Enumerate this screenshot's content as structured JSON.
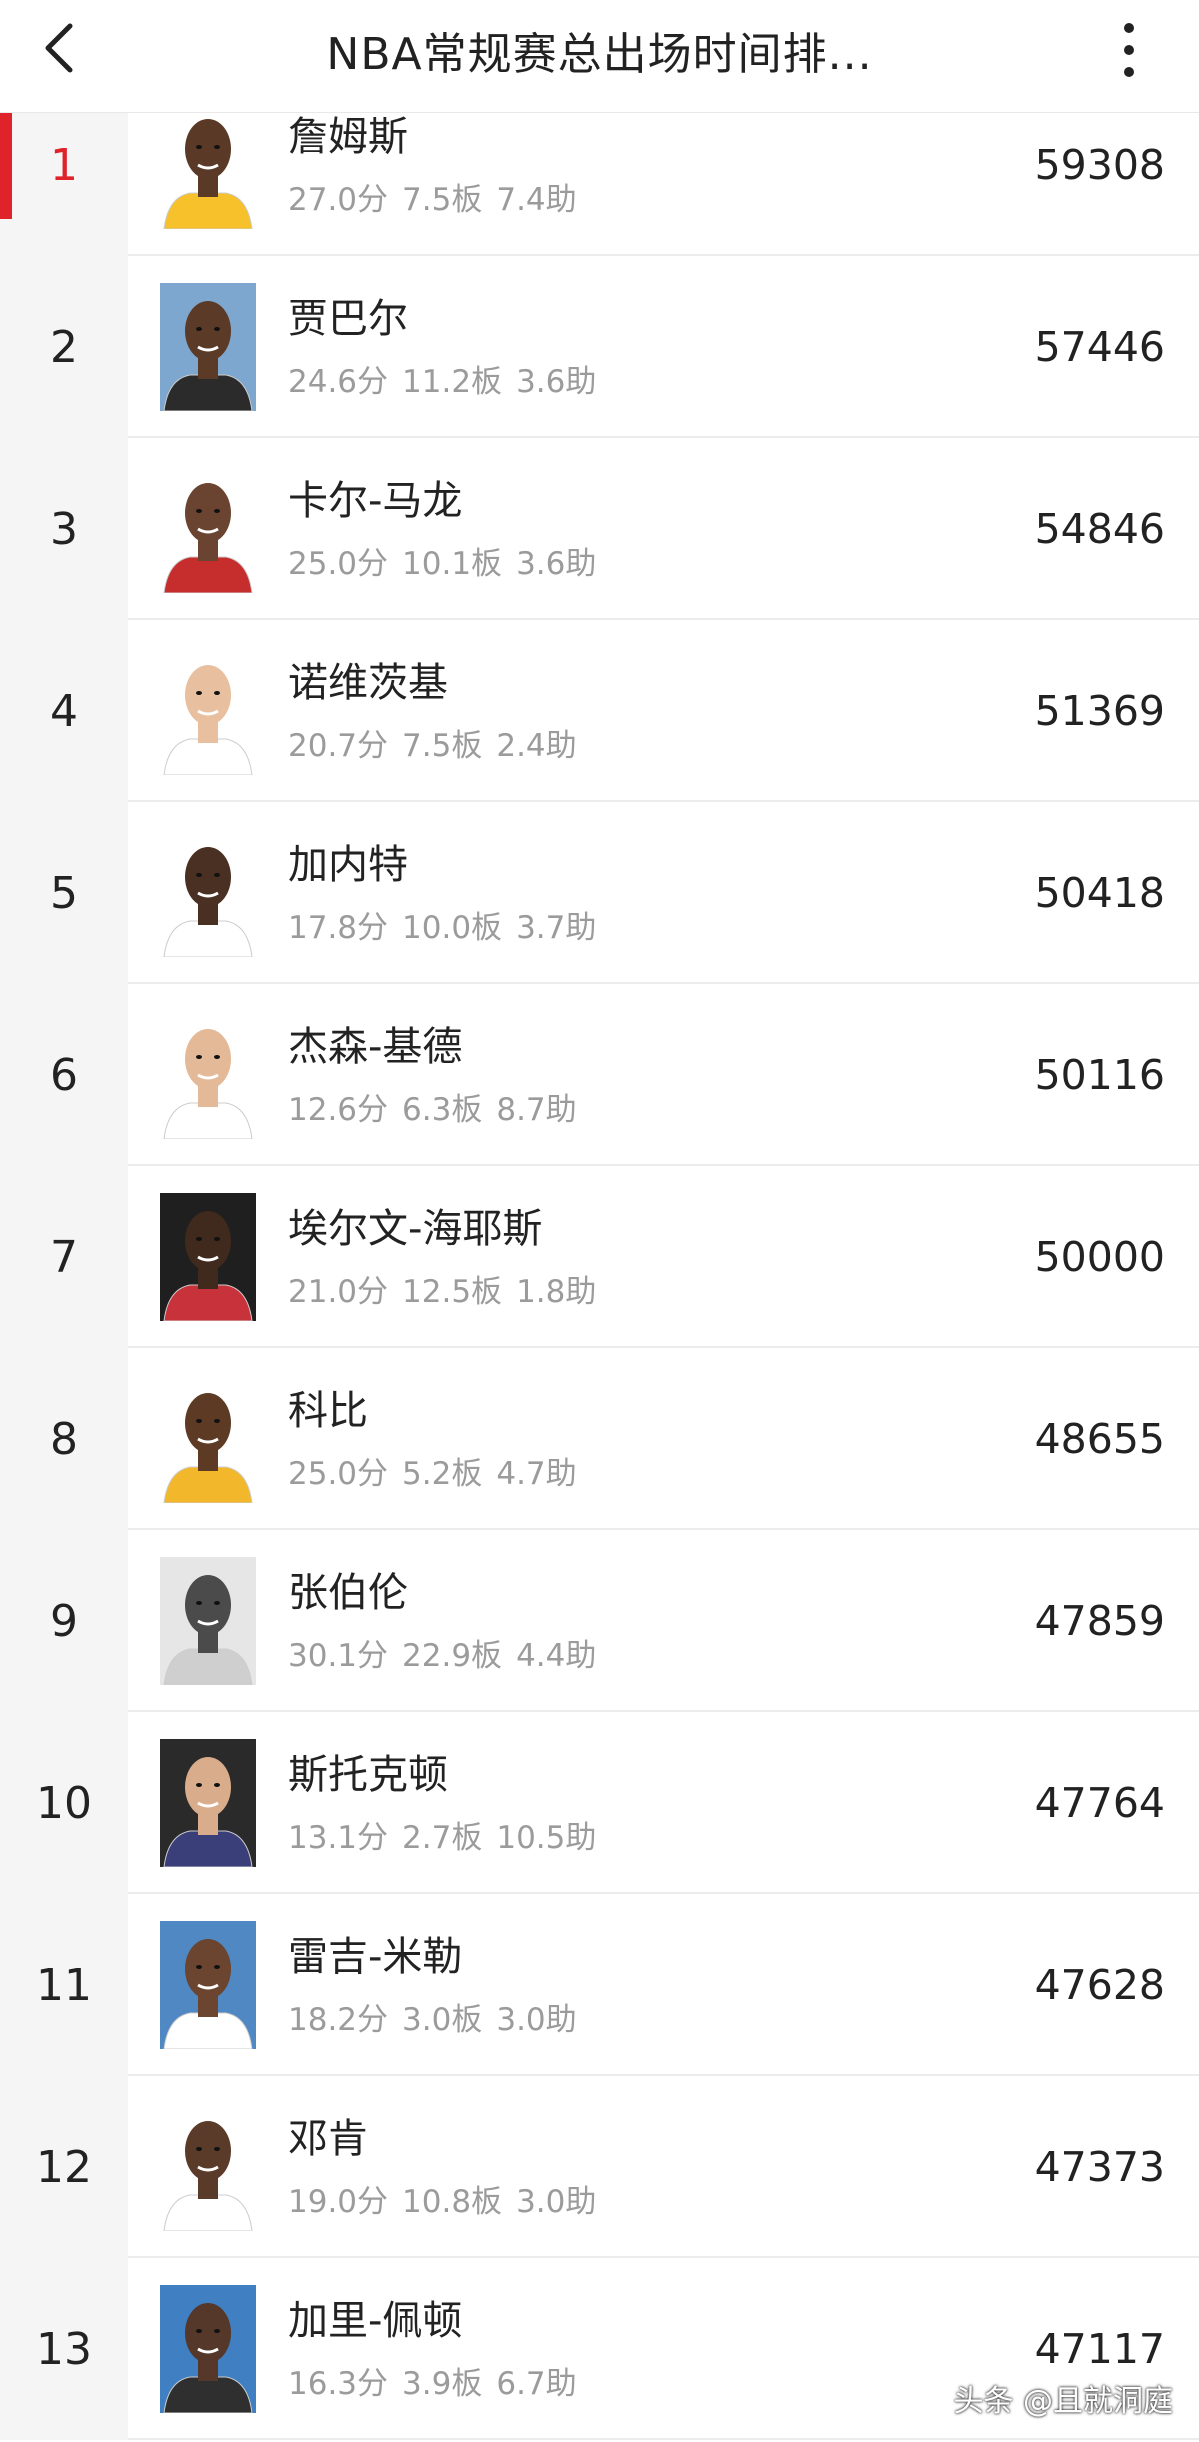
{
  "header": {
    "title": "NBA常规赛总出场时间排...",
    "back_icon": "chevron-left-icon",
    "more_icon": "more-vertical-icon"
  },
  "colors": {
    "accent": "#e0222b",
    "rank_bg": "#f5f5f5",
    "stat_text": "#9b9b9b"
  },
  "players": [
    {
      "rank": "1",
      "name": "詹姆斯",
      "pts": "27.0分",
      "reb": "7.5板",
      "ast": "7.4助",
      "minutes": "59308",
      "active": true,
      "skin": "#5a3a26",
      "jersey": "#f6c12b",
      "bg": "#ffffff"
    },
    {
      "rank": "2",
      "name": "贾巴尔",
      "pts": "24.6分",
      "reb": "11.2板",
      "ast": "3.6助",
      "minutes": "57446",
      "active": false,
      "skin": "#5b3b27",
      "jersey": "#2b2b2b",
      "bg": "#7ea7cf"
    },
    {
      "rank": "3",
      "name": "卡尔-马龙",
      "pts": "25.0分",
      "reb": "10.1板",
      "ast": "3.6助",
      "minutes": "54846",
      "active": false,
      "skin": "#6a4430",
      "jersey": "#c62d2d",
      "bg": "#ffffff"
    },
    {
      "rank": "4",
      "name": "诺维茨基",
      "pts": "20.7分",
      "reb": "7.5板",
      "ast": "2.4助",
      "minutes": "51369",
      "active": false,
      "skin": "#e8c0a0",
      "jersey": "#ffffff",
      "bg": "#ffffff"
    },
    {
      "rank": "5",
      "name": "加内特",
      "pts": "17.8分",
      "reb": "10.0板",
      "ast": "3.7助",
      "minutes": "50418",
      "active": false,
      "skin": "#4a3022",
      "jersey": "#ffffff",
      "bg": "#ffffff"
    },
    {
      "rank": "6",
      "name": "杰森-基德",
      "pts": "12.6分",
      "reb": "6.3板",
      "ast": "8.7助",
      "minutes": "50116",
      "active": false,
      "skin": "#e3b998",
      "jersey": "#ffffff",
      "bg": "#ffffff"
    },
    {
      "rank": "7",
      "name": "埃尔文-海耶斯",
      "pts": "21.0分",
      "reb": "12.5板",
      "ast": "1.8助",
      "minutes": "50000",
      "active": false,
      "skin": "#3f2a1d",
      "jersey": "#c8323a",
      "bg": "#1f1f1f"
    },
    {
      "rank": "8",
      "name": "科比",
      "pts": "25.0分",
      "reb": "5.2板",
      "ast": "4.7助",
      "minutes": "48655",
      "active": false,
      "skin": "#5c3a24",
      "jersey": "#f3b72c",
      "bg": "#ffffff"
    },
    {
      "rank": "9",
      "name": "张伯伦",
      "pts": "30.1分",
      "reb": "22.9板",
      "ast": "4.4助",
      "minutes": "47859",
      "active": false,
      "skin": "#4b4b4b",
      "jersey": "#cfcfcf",
      "bg": "#e6e6e6"
    },
    {
      "rank": "10",
      "name": "斯托克顿",
      "pts": "13.1分",
      "reb": "2.7板",
      "ast": "10.5助",
      "minutes": "47764",
      "active": false,
      "skin": "#d9ad8c",
      "jersey": "#3a3f7a",
      "bg": "#2a2a2a"
    },
    {
      "rank": "11",
      "name": "雷吉-米勒",
      "pts": "18.2分",
      "reb": "3.0板",
      "ast": "3.0助",
      "minutes": "47628",
      "active": false,
      "skin": "#6b452f",
      "jersey": "#ffffff",
      "bg": "#4f88c2"
    },
    {
      "rank": "12",
      "name": "邓肯",
      "pts": "19.0分",
      "reb": "10.8板",
      "ast": "3.0助",
      "minutes": "47373",
      "active": false,
      "skin": "#5a3a28",
      "jersey": "#ffffff",
      "bg": "#ffffff"
    },
    {
      "rank": "13",
      "name": "加里-佩顿",
      "pts": "16.3分",
      "reb": "3.9板",
      "ast": "6.7助",
      "minutes": "47117",
      "active": false,
      "skin": "#55382a",
      "jersey": "#2f2f2f",
      "bg": "#3f7fc2"
    }
  ],
  "watermark": "头条 @且就洞庭"
}
